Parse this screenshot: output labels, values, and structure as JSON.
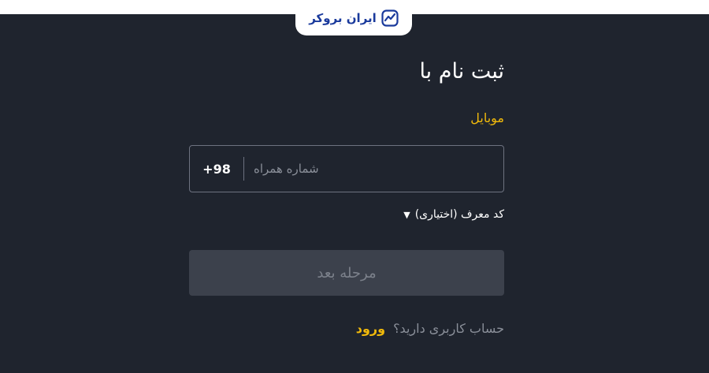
{
  "brand": {
    "name": "ایران بروکر",
    "logo_icon": "chart-trend-icon",
    "color": "#1a3a9c"
  },
  "signup": {
    "title": "ثبت نام با",
    "method_label": "موبایل",
    "phone": {
      "country_code": "+98",
      "placeholder": "شماره همراه",
      "value": ""
    },
    "referral_label": "کد معرف (اختیاری)",
    "referral_icon": "caret-down-icon",
    "next_button": "مرحله بعد"
  },
  "login": {
    "question": "حساب کاربری دارید؟",
    "link": "ورود"
  },
  "colors": {
    "background": "#1f242e",
    "accent": "#f0b90b",
    "button_disabled": "#3c414c"
  }
}
